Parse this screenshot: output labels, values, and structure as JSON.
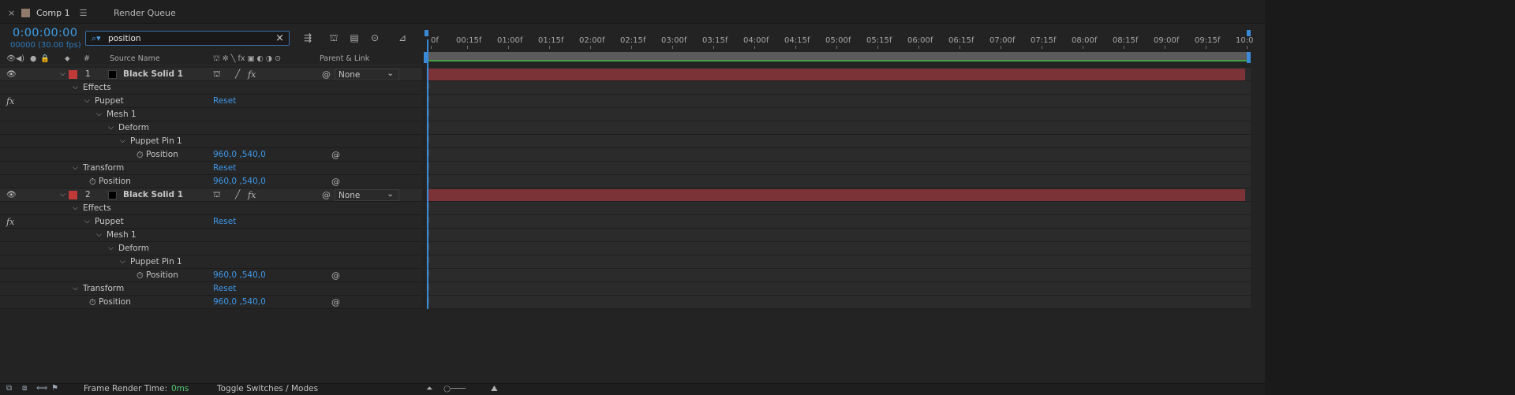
{
  "tabs": [
    {
      "label": "Comp 1",
      "active": true
    },
    {
      "label": "Render Queue",
      "active": false
    }
  ],
  "tab_close": "×",
  "tab_menu": "☰",
  "timecode": "0:00:00:00",
  "fps_label": "00000 (30.00 fps)",
  "search": {
    "value": "position",
    "clear": "×",
    "icon": "search-icon"
  },
  "columns": {
    "number": "#",
    "source_name": "Source Name",
    "parent_link": "Parent & Link"
  },
  "rows": [
    {
      "type": "layer",
      "num": "1",
      "name": "Black Solid 1",
      "parent": "None"
    },
    {
      "type": "prop",
      "label": "Effects",
      "indent": 1
    },
    {
      "type": "prop",
      "label": "Puppet",
      "indent": 2,
      "value": "Reset",
      "fx": true
    },
    {
      "type": "prop",
      "label": "Mesh 1",
      "indent": 3
    },
    {
      "type": "prop",
      "label": "Deform",
      "indent": 4
    },
    {
      "type": "prop",
      "label": "Puppet Pin 1",
      "indent": 5
    },
    {
      "type": "param",
      "label": "Position",
      "indent": 6,
      "value": "960,0 ,540,0"
    },
    {
      "type": "prop",
      "label": "Transform",
      "indent": 1,
      "value": "Reset"
    },
    {
      "type": "param",
      "label": "Position",
      "indent": 2,
      "value": "960,0 ,540,0"
    },
    {
      "type": "layer",
      "num": "2",
      "name": "Black Solid 1",
      "parent": "None"
    },
    {
      "type": "prop",
      "label": "Effects",
      "indent": 1
    },
    {
      "type": "prop",
      "label": "Puppet",
      "indent": 2,
      "value": "Reset",
      "fx": true
    },
    {
      "type": "prop",
      "label": "Mesh 1",
      "indent": 3
    },
    {
      "type": "prop",
      "label": "Deform",
      "indent": 4
    },
    {
      "type": "prop",
      "label": "Puppet Pin 1",
      "indent": 5
    },
    {
      "type": "param",
      "label": "Position",
      "indent": 6,
      "value": "960,0 ,540,0"
    },
    {
      "type": "prop",
      "label": "Transform",
      "indent": 1,
      "value": "Reset"
    },
    {
      "type": "param",
      "label": "Position",
      "indent": 2,
      "value": "960,0 ,540,0"
    }
  ],
  "ruler_ticks": [
    "0f",
    "00:15f",
    "01:00f",
    "01:15f",
    "02:00f",
    "02:15f",
    "03:00f",
    "03:15f",
    "04:00f",
    "04:15f",
    "05:00f",
    "05:15f",
    "06:00f",
    "06:15f",
    "07:00f",
    "07:15f",
    "08:00f",
    "08:15f",
    "09:00f",
    "09:15f",
    "10:0"
  ],
  "footer": {
    "frame_render_label": "Frame Render Time:",
    "frame_render_value": "0ms",
    "toggle_label": "Toggle Switches / Modes"
  },
  "colors": {
    "accent_blue": "#3d9ee8",
    "layer_label": "#c13a3a",
    "layer_bar": "#7b3338",
    "work_area": "#5b5b5b"
  }
}
